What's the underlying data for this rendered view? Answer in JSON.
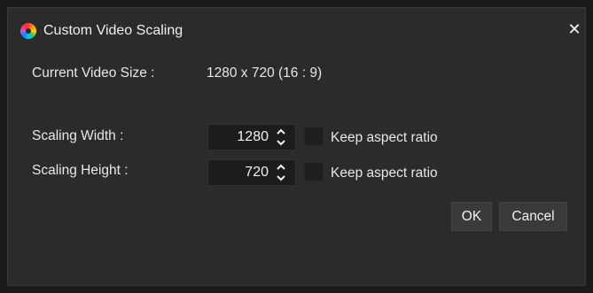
{
  "window": {
    "title": "Custom Video Scaling",
    "app_icon": "color-wheel-icon",
    "close_glyph": "✕"
  },
  "current_size": {
    "label": "Current Video Size :",
    "value": "1280 x 720 (16 : 9)"
  },
  "scaling_width": {
    "label": "Scaling Width :",
    "value": "1280",
    "keep_aspect_label": "Keep aspect ratio",
    "keep_aspect_checked": false
  },
  "scaling_height": {
    "label": "Scaling Height :",
    "value": "720",
    "keep_aspect_label": "Keep aspect ratio",
    "keep_aspect_checked": false
  },
  "buttons": {
    "ok": "OK",
    "cancel": "Cancel"
  }
}
